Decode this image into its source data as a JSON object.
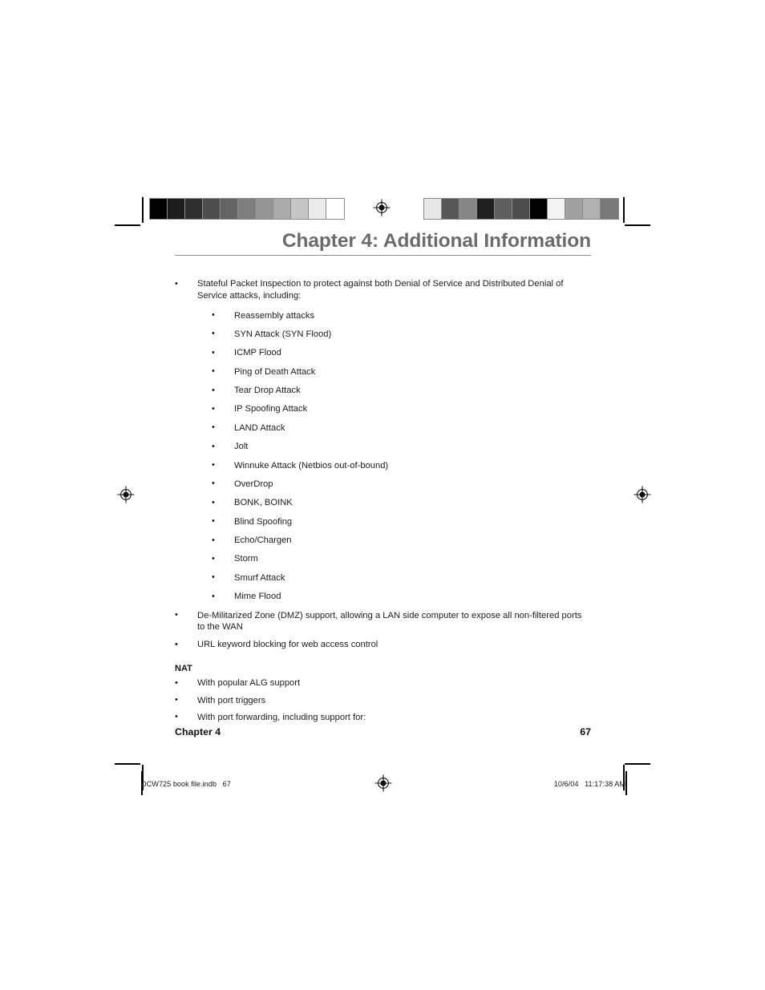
{
  "document": {
    "chapter_heading": "Chapter 4: Additional Information",
    "footer": {
      "chapter_label": "Chapter 4",
      "page_number": "67"
    },
    "proof_slug": {
      "file_label": "DCW725 book file.indb   67",
      "timestamp": "10/6/04   11:17:38 AM"
    }
  },
  "prepress": {
    "registration_icon": "registration-target-icon",
    "crop_mark_icon": "crop-mark-icon",
    "gray_bar_left": {
      "name": "grayscale-step-wedge-left",
      "swatches": [
        "#030303",
        "#1d1d1d",
        "#303030",
        "#4e4e4e",
        "#636363",
        "#7e7e7e",
        "#949494",
        "#ababab",
        "#c6c6c6",
        "#ebebeb",
        "#ffffff"
      ]
    },
    "gray_bar_right": {
      "name": "grayscale-scrambled-wedge-right",
      "swatches": [
        "#e8e8e8",
        "#565656",
        "#868686",
        "#1f1f1f",
        "#5e5e5e",
        "#4d4d4d",
        "#000000",
        "#f4f4f4",
        "#a0a0a0",
        "#b0b0b0",
        "#787878"
      ]
    }
  },
  "content": {
    "bullet_glyph": "•",
    "items": [
      {
        "text": "Stateful Packet Inspection to protect against both Denial of Service and Distributed Denial of Service attacks, including:"
      }
    ],
    "sub_items": [
      "Reassembly attacks",
      "SYN Attack (SYN Flood)",
      "ICMP Flood",
      "Ping of Death Attack",
      "Tear Drop Attack",
      "IP Spoofing Attack",
      "LAND Attack",
      "Jolt",
      "Winnuke Attack (Netbios out-of-bound)",
      "OverDrop",
      "BONK, BOINK",
      "Blind Spoofing",
      "Echo/Chargen",
      "Storm",
      "Smurf Attack",
      "Mime Flood"
    ],
    "items_after": [
      "De-Militarized Zone (DMZ) support, allowing a LAN side computer to expose all non-filtered ports to the WAN",
      "URL keyword blocking for web access control"
    ],
    "nat_section": {
      "heading": "NAT",
      "items": [
        "With popular ALG support",
        "With port triggers",
        "With port forwarding, including support for:"
      ]
    }
  }
}
